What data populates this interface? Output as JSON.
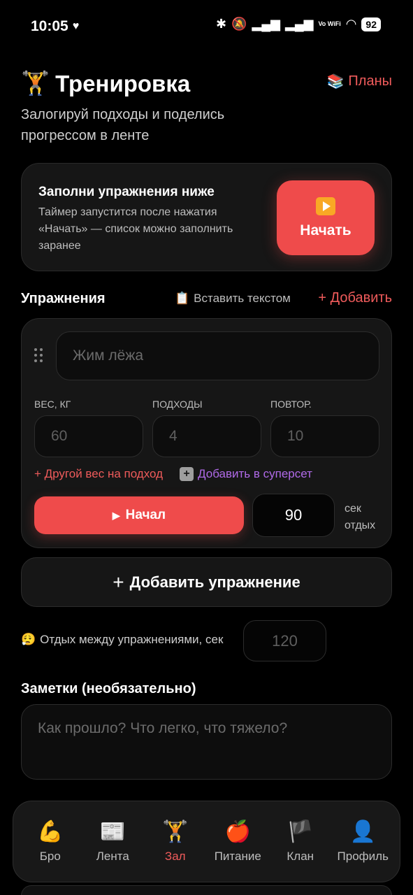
{
  "status_bar": {
    "time": "10:05",
    "network": "Vo WiFi",
    "battery": "92"
  },
  "header": {
    "title_icon": "🏋️",
    "title": "Тренировка",
    "plans_icon": "📚",
    "plans_label": "Планы",
    "subtitle": "Залогируй подходы и поделись прогрессом в ленте"
  },
  "start_card": {
    "title": "Заполни упражнения ниже",
    "text": "Таймер запустится после нажатия «Начать» — список можно заполнить заранее",
    "button_label": "Начать"
  },
  "exercises": {
    "label": "Упражнения",
    "paste_icon": "📋",
    "paste_label": "Вставить текстом",
    "add_label": "+ Добавить",
    "items": [
      {
        "name_placeholder": "Жим лёжа",
        "weight_label": "ВЕС, КГ",
        "weight_placeholder": "60",
        "sets_label": "ПОДХОДЫ",
        "sets_placeholder": "4",
        "reps_label": "ПОВТОР.",
        "reps_placeholder": "10",
        "other_weight_label": "+ Другой вес на подход",
        "superset_label": "Добавить в суперсет",
        "start_label": "Начал",
        "rest_value": "90",
        "rest_unit_1": "сек",
        "rest_unit_2": "отдых"
      }
    ]
  },
  "add_exercise_label": "Добавить упражнение",
  "rest_between": {
    "icon": "😮‍💨",
    "label": "Отдых между упражнениями, сек",
    "placeholder": "120"
  },
  "notes": {
    "label": "Заметки (необязательно)",
    "placeholder": "Как прошло? Что легко, что тяжело?"
  },
  "nav": [
    {
      "icon": "💪",
      "label": "Бро"
    },
    {
      "icon": "📰",
      "label": "Лента"
    },
    {
      "icon": "🏋️",
      "label": "Зал",
      "active": true
    },
    {
      "icon": "🍎",
      "label": "Питание"
    },
    {
      "icon": "🏴",
      "label": "Клан"
    },
    {
      "icon": "👤",
      "label": "Профиль"
    }
  ],
  "colors": {
    "accent": "#ef4b4b",
    "link_red": "#ef5b5b",
    "superset_purple": "#b06ae8",
    "card_bg": "#161616"
  }
}
